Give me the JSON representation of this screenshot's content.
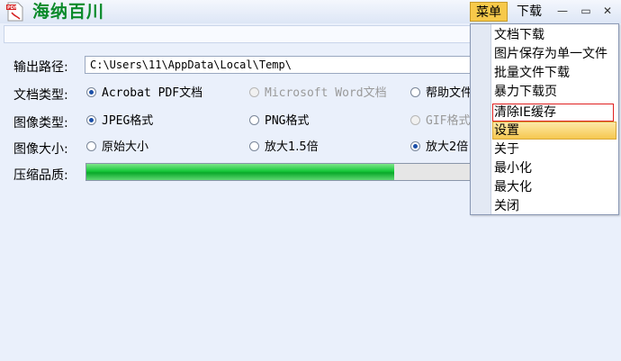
{
  "app": {
    "title": "海纳百川",
    "icon": "pdf-file-icon"
  },
  "titlebar": {
    "menu_label": "菜单",
    "download_label": "下载",
    "minimize_glyph": "—",
    "maximize_glyph": "▭",
    "close_glyph": "✕"
  },
  "output": {
    "label": "输出路径:",
    "value": "C:\\Users\\11\\AppData\\Local\\Temp\\"
  },
  "doc_type": {
    "label": "文档类型:",
    "opt1": "Acrobat PDF文档",
    "opt2": "Microsoft Word文档",
    "opt3": "帮助文件"
  },
  "image_type": {
    "label": "图像类型:",
    "opt1": "JPEG格式",
    "opt2": "PNG格式",
    "opt3": "GIF格式"
  },
  "image_size": {
    "label": "图像大小:",
    "opt1": "原始大小",
    "opt2": "放大1.5倍",
    "opt3": "放大2倍"
  },
  "quality": {
    "label": "压缩品质:",
    "level": 0.78
  },
  "menu": {
    "items": [
      "文档下载",
      "图片保存为单一文件",
      "批量文件下载",
      "暴力下载页",
      "清除IE缓存",
      "设置",
      "关于",
      "最小化",
      "最大化",
      "关闭"
    ],
    "highlighted": "设置",
    "boxed": "清除IE缓存"
  },
  "colors": {
    "title_green": "#0a8a2a",
    "highlight": "#f6c850",
    "progress": "#17c83a",
    "box_red": "#e02020"
  }
}
